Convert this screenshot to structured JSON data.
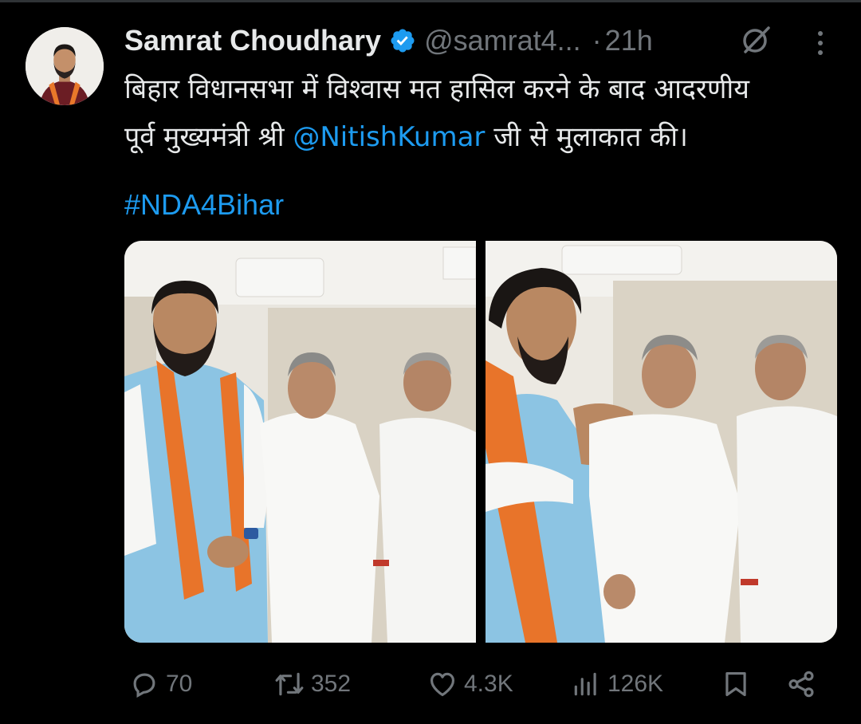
{
  "tweet": {
    "author_name": "Samrat Choudhary",
    "handle": "@samrat4...",
    "separator": "·",
    "time": "21h",
    "text_line1": "बिहार विधानसभा में विश्वास मत हासिल करने के बाद आदरणीय",
    "text_line2_before": "पूर्व मुख्यमंत्री श्री ",
    "mention": "@NitishKumar",
    "text_line2_after": " जी से मुलाकात की।",
    "hashtag": "#NDA4Bihar"
  },
  "icons": {
    "verified": "verified-badge-icon",
    "grok": "grok-icon",
    "more": "more-options-icon",
    "reply": "reply-icon",
    "repost": "repost-icon",
    "like": "like-icon",
    "views": "views-icon",
    "bookmark": "bookmark-icon",
    "share": "share-icon"
  },
  "actions": {
    "replies": "70",
    "reposts": "352",
    "likes": "4.3K",
    "views": "126K"
  },
  "colors": {
    "background": "#000000",
    "text": "#e7e9ea",
    "muted": "#71767b",
    "link": "#1d9bf0",
    "verified": "#1d9bf0"
  }
}
